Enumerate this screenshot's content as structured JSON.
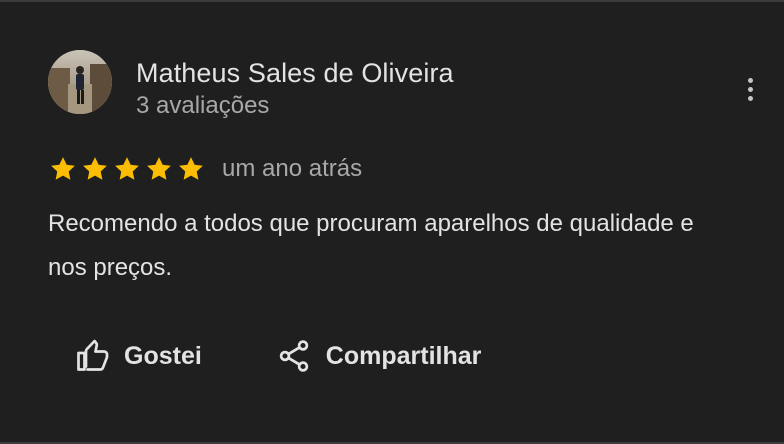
{
  "review": {
    "author_name": "Matheus Sales de Oliveira",
    "author_meta": "3 avaliações",
    "avatar_icon": "user-photo",
    "rating": 5,
    "rating_max": 5,
    "star_color": "#fbbc04",
    "time_ago": "um ano atrás",
    "text": "Recomendo a todos que procuram aparelhos de qualidade e nos preços.",
    "more_icon": "more-vertical-icon"
  },
  "actions": {
    "like_label": "Gostei",
    "like_icon": "thumbs-up-icon",
    "share_label": "Compartilhar",
    "share_icon": "share-icon"
  },
  "colors": {
    "background": "#1f1f1f",
    "text_primary": "#e3e3e3",
    "text_secondary": "#a8a8a8",
    "star": "#fbbc04"
  }
}
